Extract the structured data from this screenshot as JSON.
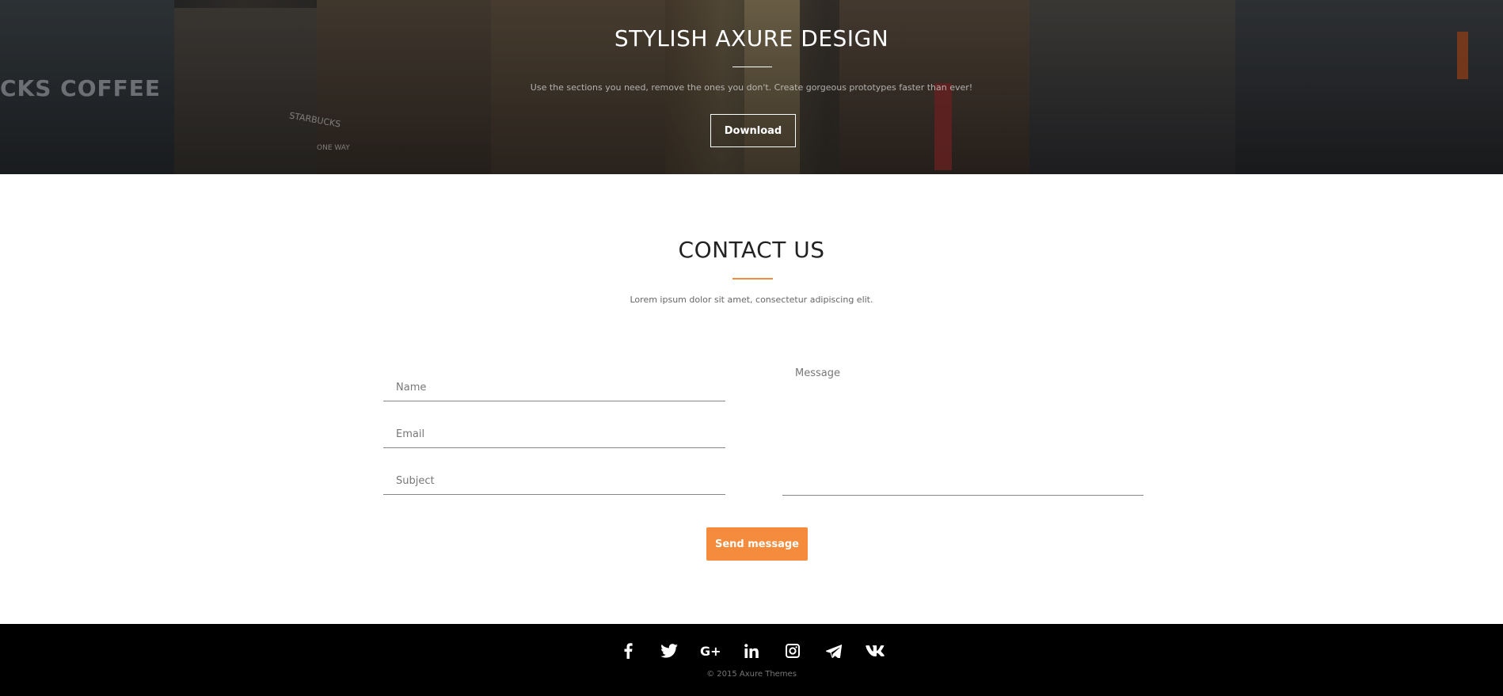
{
  "hero": {
    "title": "STYLISH AXURE DESIGN",
    "subtitle": "Use the sections you need, remove the ones you don't. Create gorgeous prototypes faster than ever!",
    "button_label": "Download",
    "background_signage": {
      "storefront": "CKS COFFEE",
      "store_name": "STARBUCKS",
      "street_sign": "ONE WAY"
    }
  },
  "contact": {
    "title": "CONTACT US",
    "subtitle": "Lorem ipsum dolor sit amet, consectetur adipiscing elit.",
    "fields": {
      "name_placeholder": "Name",
      "email_placeholder": "Email",
      "subject_placeholder": "Subject",
      "message_placeholder": "Message"
    },
    "send_label": "Send message"
  },
  "footer": {
    "social": [
      "facebook-icon",
      "twitter-icon",
      "google-plus-icon",
      "linkedin-icon",
      "instagram-icon",
      "telegram-icon",
      "vk-icon"
    ],
    "copyright": "©  2015 Axure Themes"
  },
  "colors": {
    "accent": "#f58b3c",
    "footer_bg": "#000000",
    "text_dark": "#222222"
  }
}
